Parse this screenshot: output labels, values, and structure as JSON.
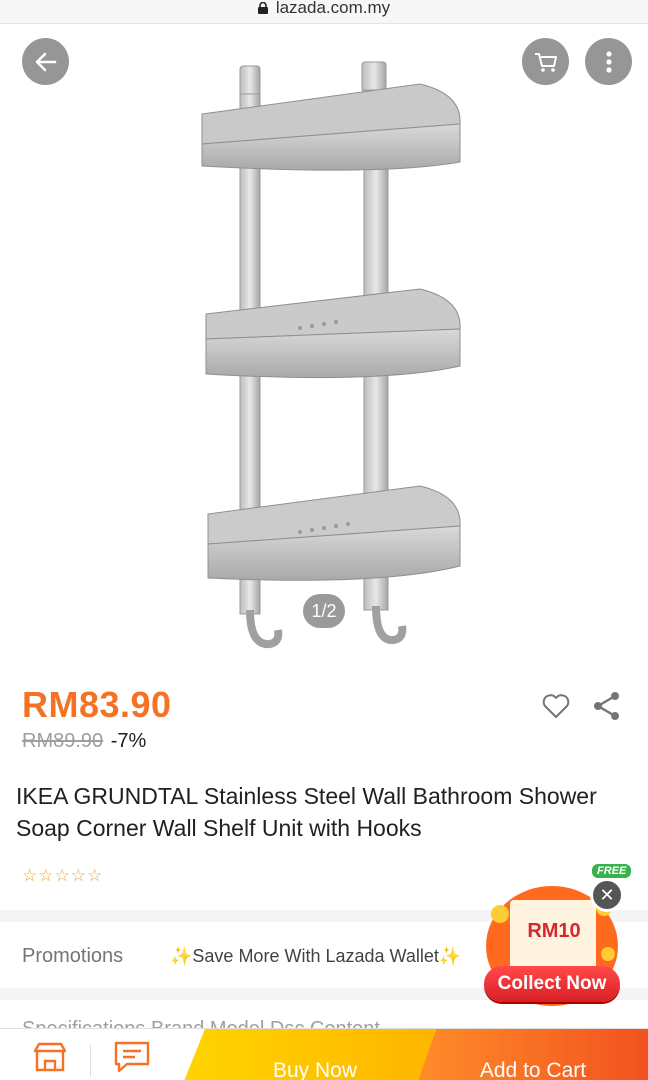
{
  "browser": {
    "url": "lazada.com.my"
  },
  "gallery": {
    "page_indicator": "1/2"
  },
  "product": {
    "price": "RM83.90",
    "original_price": "RM89.90",
    "discount": "-7%",
    "title": "IKEA GRUNDTAL Stainless Steel Wall Bathroom Shower Soap Corner Wall Shelf Unit with Hooks",
    "rating": 0,
    "rating_max": 5
  },
  "promotions": {
    "label": "Promotions",
    "text": "✨Save More With Lazada Wallet✨"
  },
  "specifications": {
    "label": "Specifications  Brand Model Dsc Content"
  },
  "coupon": {
    "free_tag": "FREE",
    "amount": "RM10",
    "collect_label": "Collect Now"
  },
  "bottom_bar": {
    "buy_now_label": "Buy Now",
    "add_to_cart_label": "Add to Cart"
  },
  "colors": {
    "price": "#f57224",
    "buy_now": "#ffc400",
    "add_to_cart": "#f2521f",
    "star": "#f5a623"
  },
  "icons": [
    "lock-icon",
    "back-arrow-icon",
    "cart-icon",
    "more-vertical-icon",
    "heart-icon",
    "share-icon",
    "store-icon",
    "chat-icon",
    "close-icon"
  ]
}
